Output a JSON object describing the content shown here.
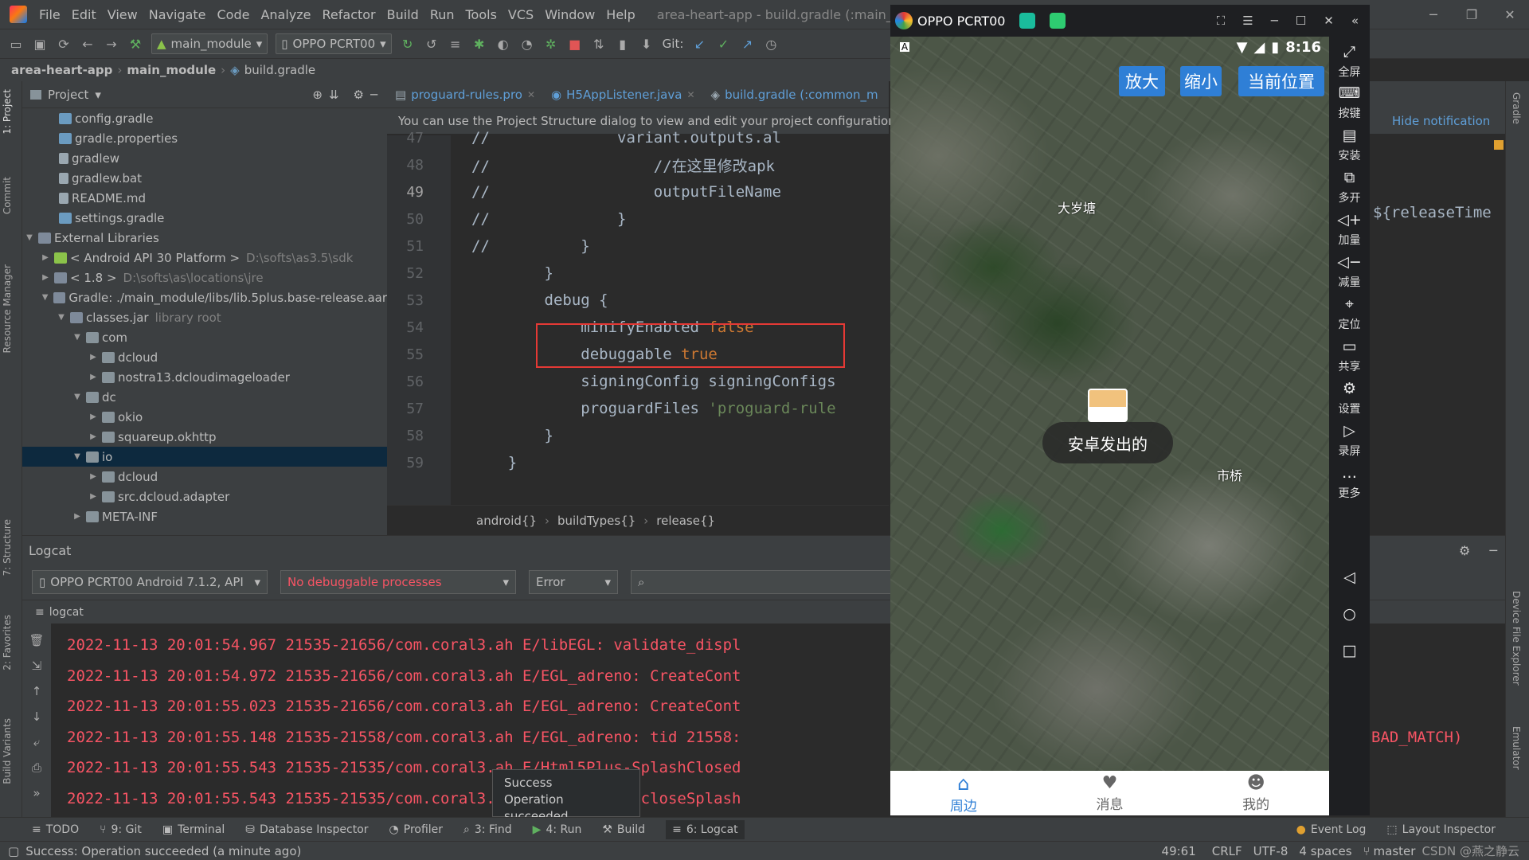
{
  "menu": {
    "items": [
      "File",
      "Edit",
      "View",
      "Navigate",
      "Code",
      "Analyze",
      "Refactor",
      "Build",
      "Run",
      "Tools",
      "VCS",
      "Window",
      "Help"
    ],
    "title": "area-heart-app - build.gradle (:main_modu"
  },
  "toolbar": {
    "module_combo": "main_module",
    "device_combo": "OPPO PCRT00",
    "git_label": "Git:"
  },
  "breadcrumb": [
    "area-heart-app",
    "main_module",
    "build.gradle"
  ],
  "project": {
    "title": "Project",
    "tree": [
      {
        "label": "config.gradle",
        "icon": "gradle"
      },
      {
        "label": "gradle.properties",
        "icon": "gradle"
      },
      {
        "label": "gradlew",
        "icon": "file"
      },
      {
        "label": "gradlew.bat",
        "icon": "file"
      },
      {
        "label": "README.md",
        "icon": "file"
      },
      {
        "label": "settings.gradle",
        "icon": "gradle"
      },
      {
        "label": "External Libraries",
        "icon": "lib"
      },
      {
        "label": "< Android API 30 Platform >",
        "hint": "D:\\softs\\as3.5\\sdk",
        "icon": "lib"
      },
      {
        "label": "< 1.8 >",
        "hint": "D:\\softs\\as\\locations\\jre",
        "icon": "lib"
      },
      {
        "label": "Gradle: ./main_module/libs/lib.5plus.base-release.aar",
        "icon": "lib"
      },
      {
        "label": "classes.jar",
        "hint": "library root",
        "icon": "lib"
      },
      {
        "label": "com",
        "icon": "folder"
      },
      {
        "label": "dcloud",
        "icon": "folder"
      },
      {
        "label": "nostra13.dcloudimageloader",
        "icon": "folder"
      },
      {
        "label": "dc",
        "icon": "folder"
      },
      {
        "label": "okio",
        "icon": "folder"
      },
      {
        "label": "squareup.okhttp",
        "icon": "folder"
      },
      {
        "label": "io",
        "icon": "folder",
        "selected": true
      },
      {
        "label": "dcloud",
        "icon": "folder"
      },
      {
        "label": "src.dcloud.adapter",
        "icon": "folder"
      },
      {
        "label": "META-INF",
        "icon": "folder"
      }
    ]
  },
  "editor": {
    "tabs": [
      "proguard-rules.pro",
      "H5AppListener.java",
      "build.gradle (:common_m"
    ],
    "notice": "You can use the Project Structure dialog to view and edit your project configuration",
    "lines": [
      {
        "n": "47",
        "t": "//              variant.outputs.al"
      },
      {
        "n": "48",
        "t": "//                  //在这里修改apk"
      },
      {
        "n": "49",
        "t": "//                  outputFileName"
      },
      {
        "n": "50",
        "t": "//              }"
      },
      {
        "n": "51",
        "t": "//          }"
      },
      {
        "n": "52",
        "t": "        }"
      },
      {
        "n": "53",
        "t": "        debug {"
      },
      {
        "n": "54",
        "t": "            minifyEnabled false"
      },
      {
        "n": "55",
        "t": "            debuggable true"
      },
      {
        "n": "56",
        "t": "            signingConfig signingConfigs"
      },
      {
        "n": "57",
        "t": "            proguardFiles 'proguard-rule"
      },
      {
        "n": "58",
        "t": "        }"
      },
      {
        "n": "59",
        "t": "    }"
      }
    ],
    "crumbs": [
      "android{}",
      "buildTypes{}",
      "release{}"
    ],
    "right_code": "${releaseTime",
    "hide_notification": "Hide notification"
  },
  "logcat": {
    "title": "Logcat",
    "device": "OPPO PCRT00 Android 7.1.2, API",
    "process": "No debuggable processes",
    "level": "Error",
    "sub": "logcat",
    "lines": [
      "2022-11-13 20:01:54.967 21535-21656/com.coral3.ah E/libEGL: validate_displ",
      "2022-11-13 20:01:54.972 21535-21656/com.coral3.ah E/EGL_adreno: CreateCont",
      "2022-11-13 20:01:55.023 21535-21656/com.coral3.ah E/EGL_adreno: CreateCont",
      "2022-11-13 20:01:55.148 21535-21558/com.coral3.ah E/EGL_adreno: tid 21558:",
      "2022-11-13 20:01:55.543 21535-21535/com.coral3.ah E/Html5Plus-SplashClosed",
      "2022-11-13 20:01:55.543 21535-21535/com.coral3.ah E/Main Path: closeSplash"
    ],
    "right_tail": "BAD_MATCH)"
  },
  "toast": {
    "title": "Success",
    "body": "Operation succeeded"
  },
  "bottom_tabs": [
    "TODO",
    "9: Git",
    "Terminal",
    "Database Inspector",
    "Profiler",
    "3: Find",
    "4: Run",
    "Build",
    "6: Logcat",
    "Event Log",
    "Layout Inspector"
  ],
  "status": {
    "message": "Success: Operation succeeded (a minute ago)",
    "position": "49:61",
    "line_sep": "CRLF",
    "encoding": "UTF-8",
    "indent": "4 spaces",
    "branch": "master",
    "watermark": "CSDN @燕之静云"
  },
  "side_tabs_left": [
    "1: Project",
    "Commit",
    "Resource Manager",
    "7: Structure",
    "2: Favorites",
    "Build Variants"
  ],
  "side_tabs_right": [
    "Gradle",
    "Device File Explorer",
    "Emulator"
  ],
  "emulator": {
    "title": "OPPO PCRT00",
    "time": "8:16",
    "map_buttons": [
      "放大",
      "缩小",
      "当前位置"
    ],
    "labels": [
      "大岁塘",
      "市桥"
    ],
    "toast": "安卓发出的",
    "nav": [
      {
        "label": "周边",
        "active": true
      },
      {
        "label": "消息"
      },
      {
        "label": "我的"
      }
    ],
    "side_buttons": [
      "全屏",
      "按键",
      "安装",
      "多开",
      "加量",
      "减量",
      "定位",
      "共享",
      "设置",
      "录屏",
      "更多"
    ]
  }
}
